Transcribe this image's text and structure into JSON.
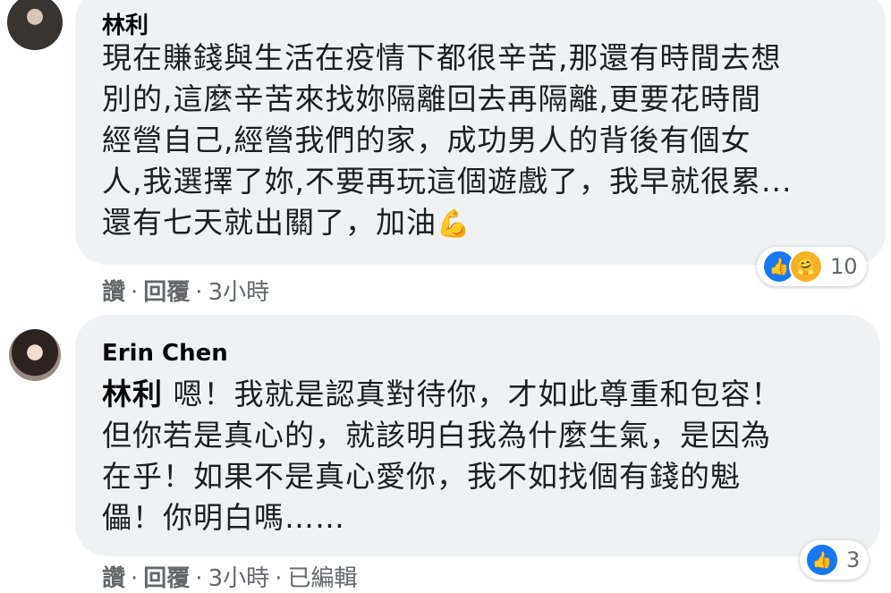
{
  "comments": [
    {
      "author": "林利",
      "lines": [
        "現在賺錢與生活在疫情下都很辛苦,那還有時間去想",
        "別的,這麼辛苦來找妳隔離回去再隔離,更要花時間",
        "經營自己,經營我們的家，成功男人的背後有個女",
        "人,我選擇了妳,不要再玩這個遊戲了，我早就很累...",
        "還有七天就出關了，加油"
      ],
      "trailing_emoji": "💪",
      "actions": {
        "like": "讚",
        "reply": "回覆",
        "time": "3小時"
      },
      "reactions": {
        "icons": [
          "like-icon",
          "care-icon"
        ],
        "count": "10"
      }
    },
    {
      "author": "Erin Chen",
      "mention": "林利",
      "lines": [
        " 嗯！我就是認真對待你，才如此尊重和包容！",
        "但你若是真心的，就該明白我為什麼生氣，是因為",
        "在乎！如果不是真心愛你，我不如找個有錢的魁",
        "儡！你明白嗎……"
      ],
      "actions": {
        "like": "讚",
        "reply": "回覆",
        "time": "3小時",
        "edited": "已編輯"
      },
      "reactions": {
        "icons": [
          "like-icon"
        ],
        "count": "3"
      }
    }
  ]
}
